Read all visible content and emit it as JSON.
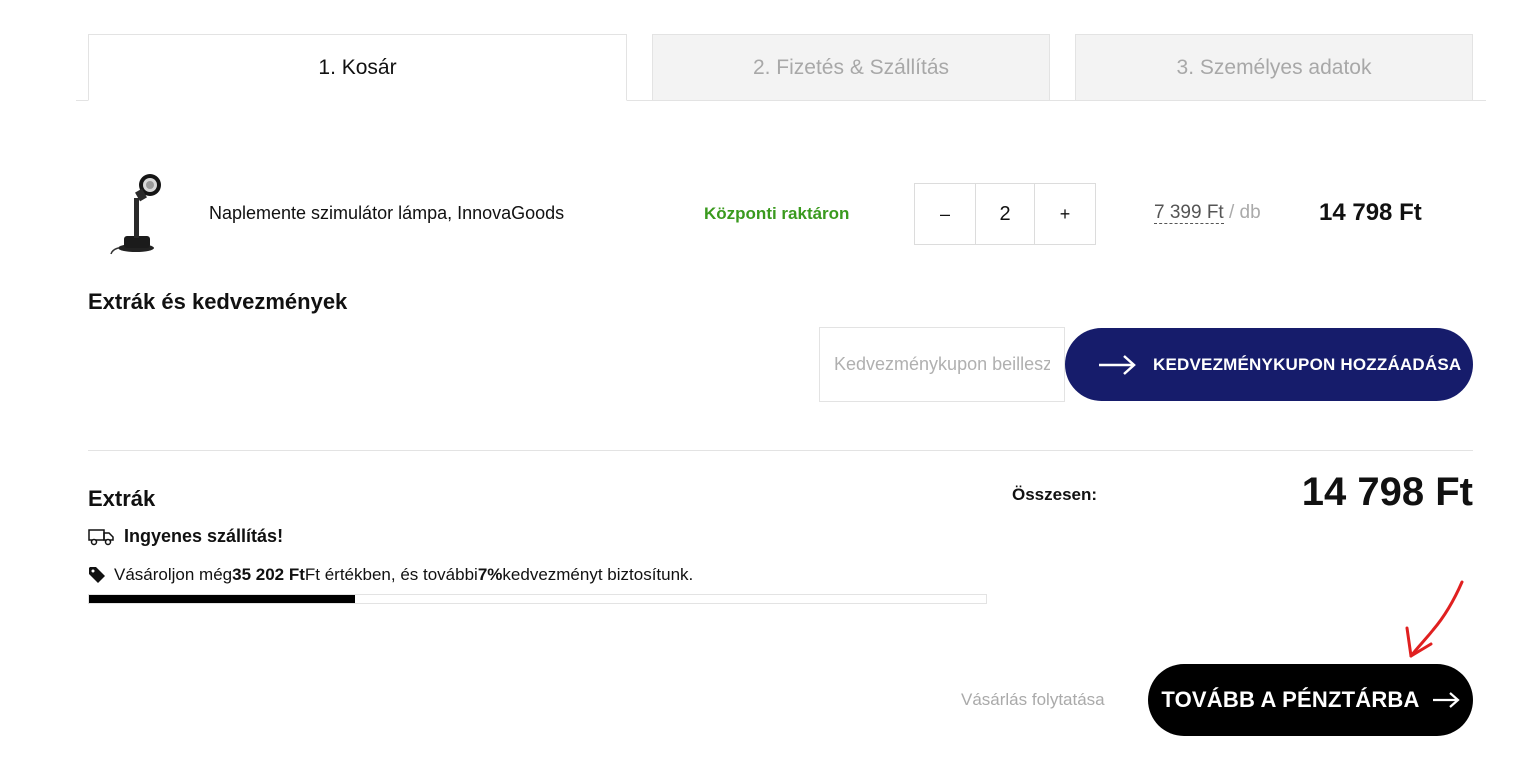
{
  "tabs": [
    {
      "label": "1. Kosár"
    },
    {
      "label": "2. Fizetés & Szállítás"
    },
    {
      "label": "3. Személyes adatok"
    }
  ],
  "cart_item": {
    "name": "Naplemente szimulátor lámpa, InnovaGoods",
    "stock": "Központi raktáron",
    "quantity": "2",
    "minus_label": "–",
    "plus_label": "+",
    "unit_price": "7 399 Ft",
    "unit_suffix": " / db",
    "total": "14 798 Ft"
  },
  "extras_section": {
    "title": "Extrák és kedvezmények",
    "coupon_placeholder": "Kedvezménykupon beillesztése",
    "coupon_button": "KEDVEZMÉNYKUPON HOZZÁADÁSA"
  },
  "summary": {
    "extras_title": "Extrák",
    "shipping_text": "Ingyenes szállítás!",
    "promo_prefix": "Vásároljon még ",
    "promo_amount": "35 202 Ft",
    "promo_middle": " Ft értékben, és további ",
    "promo_percent": "7%",
    "promo_suffix": " kedvezményt biztosítunk.",
    "progress_fraction": 0.297,
    "total_label": "Összesen:",
    "total_value": "14 798 Ft"
  },
  "actions": {
    "continue_shopping": "Vásárlás folytatása",
    "checkout": "TOVÁBB A PÉNZTÁRBA"
  },
  "colors": {
    "stock_green": "#3a9a1e",
    "coupon_button_bg": "#161c6b",
    "checkout_bg": "#000000",
    "annotation_arrow": "#e02020"
  },
  "icons": {
    "shipping": "truck-icon",
    "promo": "tag-icon",
    "coupon_arrow": "arrow-right-icon",
    "checkout_arrow": "arrow-right-icon"
  }
}
